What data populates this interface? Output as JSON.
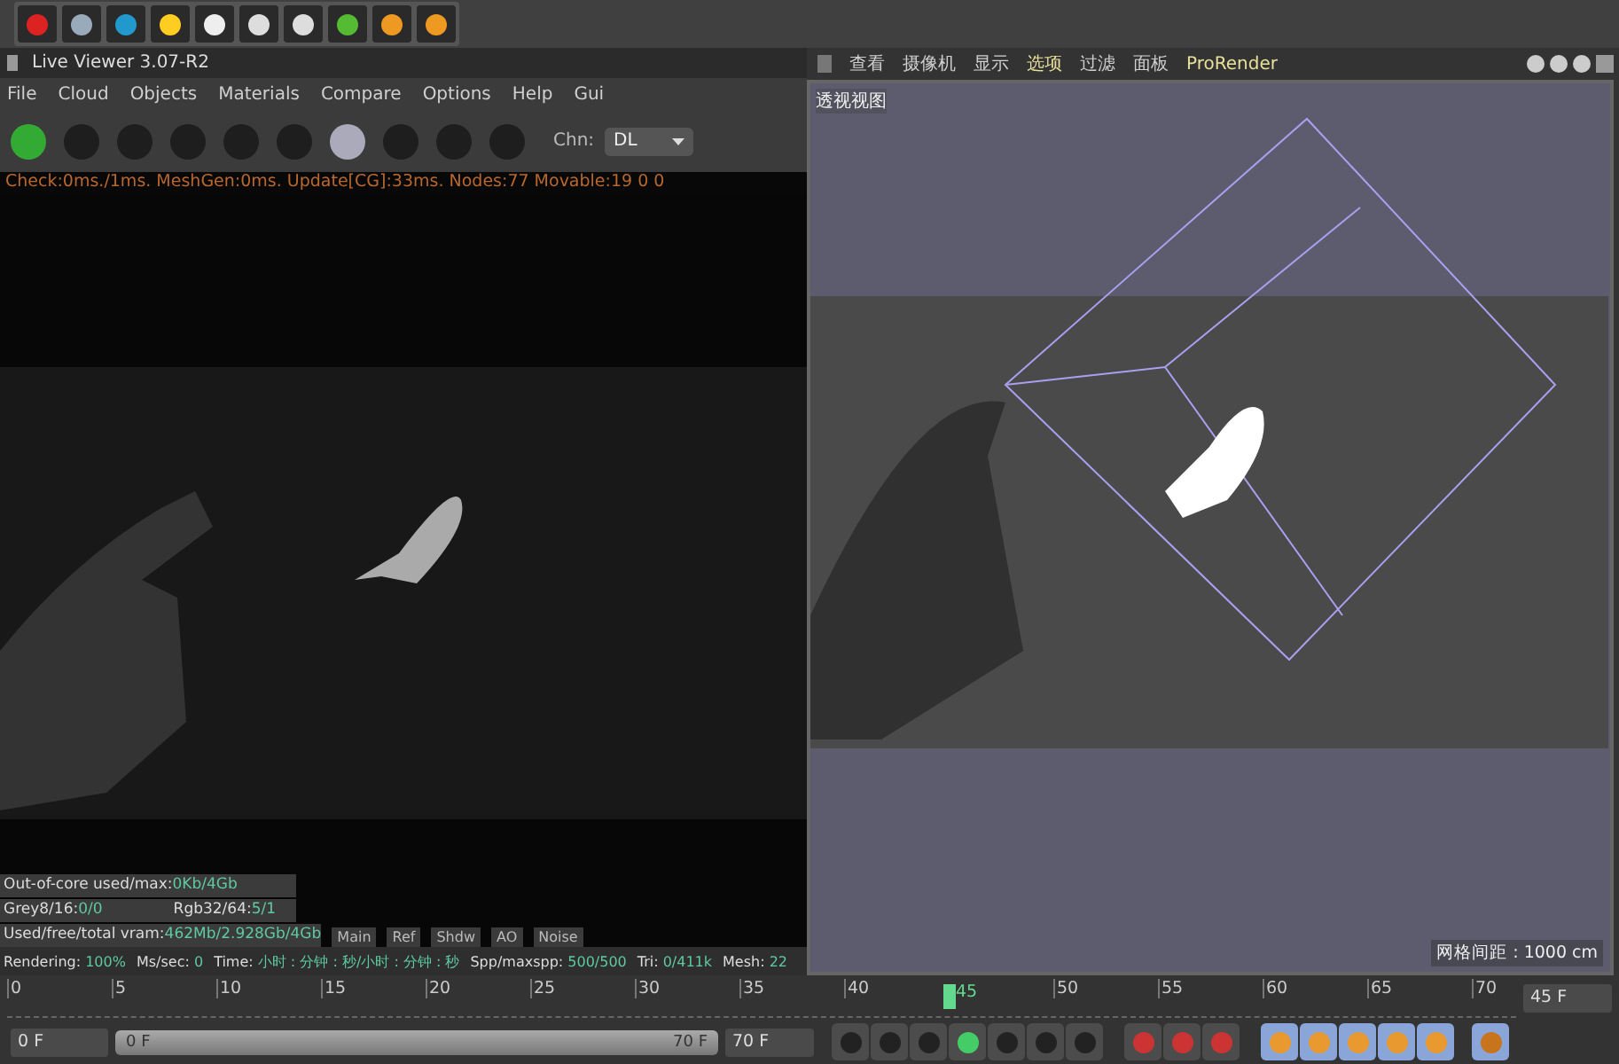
{
  "live_viewer": {
    "title": "Live Viewer 3.07-R2",
    "menu": [
      "File",
      "Cloud",
      "Objects",
      "Materials",
      "Compare",
      "Options",
      "Help",
      "Gui"
    ],
    "channel": {
      "label": "Chn:",
      "value": "DL"
    },
    "status_line": "Check:0ms./1ms. MeshGen:0ms. Update[CG]:33ms. Nodes:77 Movable:19  0 0",
    "stats": [
      {
        "label": "Out-of-core used/max:",
        "value": "0Kb/4Gb"
      },
      {
        "label": "Grey8/16: ",
        "value": "0/0",
        "label_2": "Rgb32/64: ",
        "value_2": "5/1"
      },
      {
        "label": "Used/free/total vram: ",
        "value": "462Mb/2.928Gb/4Gb"
      }
    ],
    "passes": [
      "Main",
      "Ref",
      "Shdw",
      "AO",
      "Noise"
    ],
    "status_bar": [
      {
        "label": "Rendering: ",
        "value": "100%"
      },
      {
        "label": "Ms/sec: ",
        "value": "0"
      },
      {
        "label": "Time: ",
        "value": "小时 : 分钟 : 秒/小时 : 分钟 : 秒"
      },
      {
        "label": "Spp/maxspp: ",
        "value": "500/500"
      },
      {
        "label": "Tri: ",
        "value": "0/411k"
      },
      {
        "label": "Mesh: ",
        "value": "22"
      }
    ]
  },
  "viewport": {
    "menu": [
      {
        "label": "查看",
        "highlighted": false
      },
      {
        "label": "摄像机",
        "highlighted": false
      },
      {
        "label": "显示",
        "highlighted": false
      },
      {
        "label": "选项",
        "highlighted": true
      },
      {
        "label": "过滤",
        "highlighted": false
      },
      {
        "label": "面板",
        "highlighted": false
      },
      {
        "label": "ProRender",
        "highlighted": true
      }
    ],
    "view_name": "透视视图",
    "grid_spacing": "网格间距 : 1000 cm"
  },
  "timeline": {
    "ticks": [
      {
        "label": "0",
        "current": false
      },
      {
        "label": "5",
        "current": false
      },
      {
        "label": "10",
        "current": false
      },
      {
        "label": "15",
        "current": false
      },
      {
        "label": "20",
        "current": false
      },
      {
        "label": "25",
        "current": false
      },
      {
        "label": "30",
        "current": false
      },
      {
        "label": "35",
        "current": false
      },
      {
        "label": "40",
        "current": false
      },
      {
        "label": "45",
        "current": true
      },
      {
        "label": "50",
        "current": false
      },
      {
        "label": "55",
        "current": false
      },
      {
        "label": "60",
        "current": false
      },
      {
        "label": "65",
        "current": false
      },
      {
        "label": "70",
        "current": false
      }
    ],
    "current_frame": "45 F",
    "start_frame": "0 F",
    "range": {
      "start": "0 F",
      "end": "70 F",
      "level": 1
    },
    "end_frame": "70 F"
  }
}
